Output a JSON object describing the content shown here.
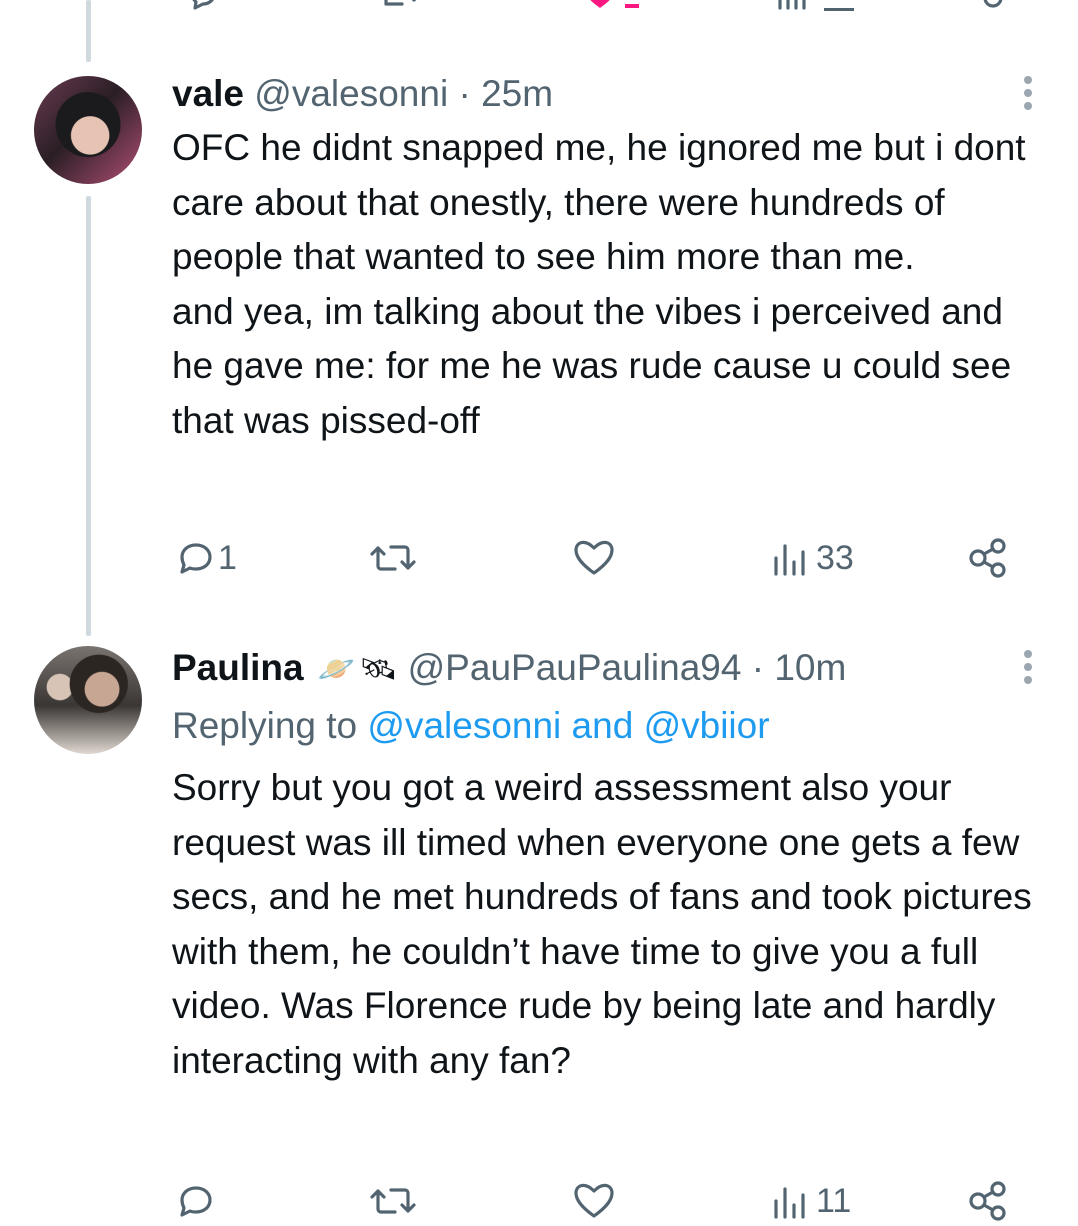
{
  "tweets": [
    {
      "display_name": "vale",
      "handle": "@valesonni",
      "separator": "·",
      "time": "25m",
      "text": "OFC he didnt snapped me, he ignored me but i dont care about that onestly, there were hundreds of people that wanted to see him more than me.\nand yea, im talking about the vibes i perceived and he gave me: for me he was rude cause u could see that was pissed-off",
      "actions": {
        "replies": "1",
        "retweets": "",
        "likes": "",
        "views": "33"
      }
    },
    {
      "display_name": "Paulina",
      "name_emojis": [
        "🪐",
        "🛰"
      ],
      "handle": "@PauPauPaulina94",
      "separator": "·",
      "time": "10m",
      "replying_prefix": "Replying to",
      "replying_to": "@valesonni and @vbiior",
      "text": "Sorry but you got a weird assessment also your request was ill timed when everyone one gets a few secs, and he met hundreds of fans and took pictures with them, he couldn’t have time to give you a full video. Was Florence rude by being late and hardly interacting with any fan?",
      "actions": {
        "replies": "",
        "retweets": "",
        "likes": "",
        "views": "11"
      }
    }
  ],
  "icons": {
    "reply": "reply-icon",
    "retweet": "retweet-icon",
    "like": "heart-icon",
    "views": "views-icon",
    "share": "share-icon",
    "more": "more-options-icon"
  },
  "colors": {
    "text": "#0f1419",
    "secondary": "#536471",
    "link": "#1d9bf0",
    "thread_line": "#cfd9de",
    "like_active": "#f91880"
  }
}
